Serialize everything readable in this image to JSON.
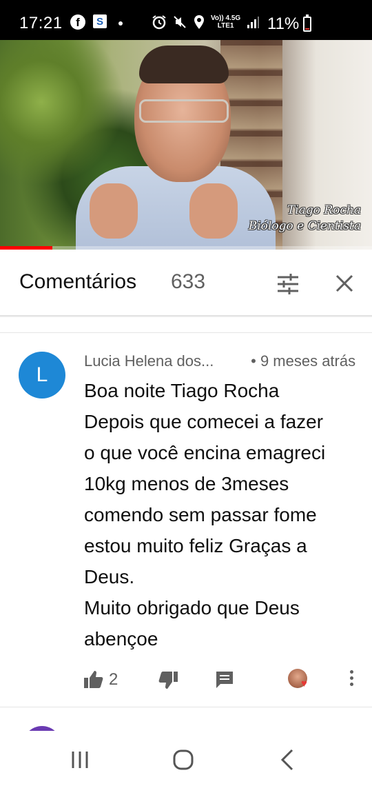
{
  "status_bar": {
    "time": "17:21",
    "notification_icons": [
      "facebook-icon",
      "s-app-icon",
      "dot-icon"
    ],
    "system_icons": [
      "alarm-icon",
      "mute-icon",
      "location-icon",
      "volte-icon",
      "4g-icon",
      "signal-icon"
    ],
    "net_label_top": "Vo)) 4.5G",
    "net_label_bottom": "LTE1",
    "battery": "11%",
    "battery_level": 0.11
  },
  "video": {
    "caption_line1": "Tiago Rocha",
    "caption_line2": "Biólogo e Cientista",
    "progress": 0.14,
    "progress_color": "#ff0000"
  },
  "comments": {
    "title": "Comentários",
    "count": "633",
    "sort_icon": "sort-filter-icon",
    "close_icon": "close-icon"
  },
  "comment": {
    "avatar_letter": "L",
    "avatar_color": "#1e88d6",
    "author": "Lucia Helena dos...",
    "time": "• 9 meses atrás",
    "lines": [
      "Boa noite Tiago Rocha",
      "Depois que comecei a fazer",
      "o que você encina emagreci",
      "10kg menos de 3meses",
      "comendo sem passar fome",
      "estou muito feliz Graças a",
      "Deus.",
      "Muito obrigado que Deus",
      "abençoe"
    ],
    "likes": "2",
    "action_icons": [
      "thumbs-up-icon",
      "thumbs-down-icon",
      "reply-icon",
      "creator-heart-icon",
      "more-vert-icon"
    ]
  },
  "navbar": {
    "icons": [
      "recent-apps-icon",
      "home-icon",
      "back-icon"
    ]
  }
}
